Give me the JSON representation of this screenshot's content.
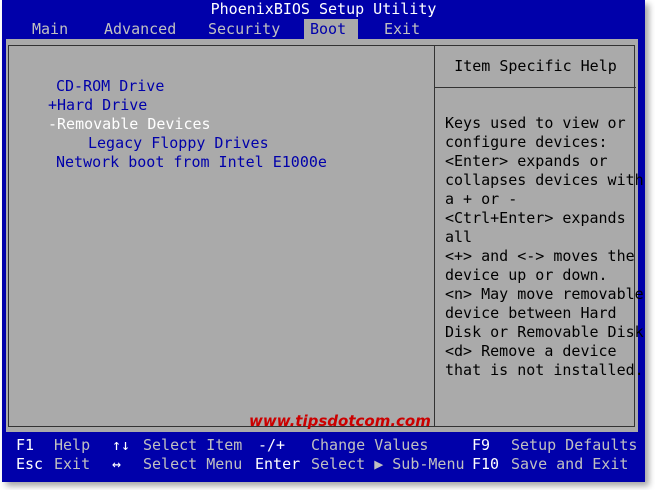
{
  "title": "PhoenixBIOS Setup Utility",
  "menu": [
    {
      "label": "Main",
      "active": false
    },
    {
      "label": "Advanced",
      "active": false
    },
    {
      "label": "Security",
      "active": false
    },
    {
      "label": "Boot",
      "active": true
    },
    {
      "label": "Exit",
      "active": false
    }
  ],
  "boot_items": [
    {
      "label": "CD-ROM Drive",
      "selected": false
    },
    {
      "label": "+Hard Drive",
      "selected": false
    },
    {
      "label": "-Removable Devices",
      "selected": true
    },
    {
      "label": "Legacy Floppy Drives",
      "selected": false
    },
    {
      "label": "Network boot from Intel E1000e",
      "selected": false
    }
  ],
  "help": {
    "title": "Item Specific Help",
    "lines": [
      "Keys used to view or",
      "configure devices:",
      "<Enter> expands or",
      "collapses devices with",
      "a + or -",
      "<Ctrl+Enter> expands",
      "all",
      "<+> and <-> moves the",
      "device up or down.",
      "<n> May move removable",
      "device between Hard",
      "Disk or Removable Disk",
      "<d> Remove a device",
      "that is not installed."
    ]
  },
  "watermark": "www.tipsdotcom.com",
  "status": {
    "row1": [
      {
        "key": "F1",
        "desc": "Help"
      },
      {
        "key": "↑↓",
        "desc": "Select Item"
      },
      {
        "key": "-/+",
        "desc": "Change Values"
      },
      {
        "key": "F9",
        "desc": "Setup Defaults"
      }
    ],
    "row2": [
      {
        "key": "Esc",
        "desc": "Exit"
      },
      {
        "key": "↔",
        "desc": "Select Menu"
      },
      {
        "key": "Enter",
        "desc": "Select ▶ Sub-Menu"
      },
      {
        "key": "F10",
        "desc": "Save and Exit"
      }
    ]
  },
  "colors": {
    "bios_blue": "#0000aa",
    "panel_gray": "#aaaaaa",
    "highlight_white": "#ffffff",
    "watermark_red": "#cc0000"
  }
}
